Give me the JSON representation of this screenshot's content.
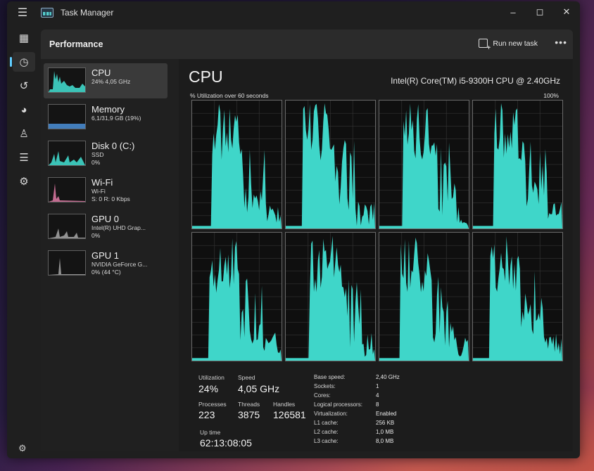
{
  "window": {
    "title": "Task Manager"
  },
  "header": {
    "title": "Performance",
    "run_task_label": "Run new task"
  },
  "sidebar": {
    "items": [
      {
        "name": "CPU",
        "sub1": "24%  4,05 GHz",
        "sub2": "",
        "sub3": ""
      },
      {
        "name": "Memory",
        "sub1": "6,1/31,9 GB (19%)",
        "sub2": "",
        "sub3": ""
      },
      {
        "name": "Disk 0 (C:)",
        "sub1": "SSD",
        "sub2": "0%",
        "sub3": ""
      },
      {
        "name": "Wi-Fi",
        "sub1": "Wi-Fi",
        "sub2": "S: 0  R: 0 Kbps",
        "sub3": ""
      },
      {
        "name": "GPU 0",
        "sub1": "Intel(R) UHD Grap...",
        "sub2": "0%",
        "sub3": ""
      },
      {
        "name": "GPU 1",
        "sub1": "NVIDIA GeForce G...",
        "sub2": "0% (44 °C)",
        "sub3": ""
      }
    ]
  },
  "main": {
    "title": "CPU",
    "model": "Intel(R) Core(TM) i5-9300H CPU @ 2.40GHz",
    "util_label": "% Utilization over 60 seconds",
    "util_max": "100%"
  },
  "stats": {
    "utilization_label": "Utilization",
    "utilization": "24%",
    "speed_label": "Speed",
    "speed": "4,05 GHz",
    "processes_label": "Processes",
    "processes": "223",
    "threads_label": "Threads",
    "threads": "3875",
    "handles_label": "Handles",
    "handles": "126581",
    "uptime_label": "Up time",
    "uptime": "62:13:08:05"
  },
  "details": [
    {
      "key": "Base speed:",
      "value": "2,40 GHz"
    },
    {
      "key": "Sockets:",
      "value": "1"
    },
    {
      "key": "Cores:",
      "value": "4"
    },
    {
      "key": "Logical processors:",
      "value": "8"
    },
    {
      "key": "Virtualization:",
      "value": "Enabled"
    },
    {
      "key": "L1 cache:",
      "value": "256 KB"
    },
    {
      "key": "L2 cache:",
      "value": "1,0 MB"
    },
    {
      "key": "L3 cache:",
      "value": "8,0 MB"
    }
  ],
  "colors": {
    "graph_fill": "#3fd6c9",
    "accent": "#60cdff"
  },
  "icons": {
    "rail": [
      "processes-icon",
      "performance-icon",
      "app-history-icon",
      "startup-icon",
      "users-icon",
      "details-icon",
      "services-icon"
    ],
    "settings": "gear-icon"
  }
}
